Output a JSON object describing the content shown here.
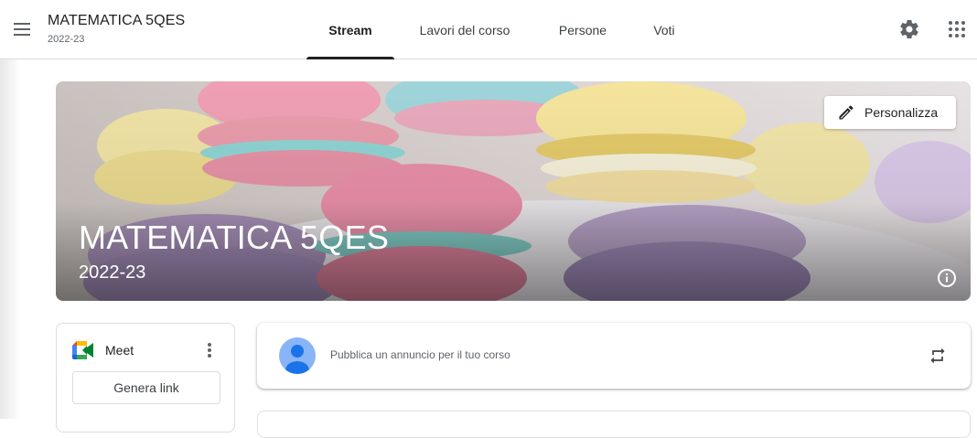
{
  "header": {
    "class_name": "MATEMATICA 5QES",
    "class_year": "2022-23",
    "menu_icon": "hamburger-menu-icon",
    "settings_icon": "gear-icon",
    "apps_icon": "apps-grid-icon"
  },
  "tabs": [
    {
      "label": "Stream",
      "active": true
    },
    {
      "label": "Lavori del corso",
      "active": false
    },
    {
      "label": "Persone",
      "active": false
    },
    {
      "label": "Voti",
      "active": false
    }
  ],
  "banner": {
    "title": "MATEMATICA 5QES",
    "subtitle": "2022-23",
    "customize_label": "Personalizza",
    "customize_icon": "pencil-icon",
    "info_icon": "info-icon"
  },
  "meet": {
    "title": "Meet",
    "generate_link_label": "Genera link",
    "logo_icon": "google-meet-icon",
    "more_icon": "more-vert-icon"
  },
  "announcement": {
    "placeholder": "Pubblica un annuncio per il tuo corso",
    "avatar_icon": "user-avatar-icon",
    "repost_icon": "repost-icon"
  },
  "colors": {
    "accent": "#202124",
    "border": "#dadce0",
    "avatar_bg": "#8ab4f8",
    "avatar_fg": "#1a73e8"
  }
}
